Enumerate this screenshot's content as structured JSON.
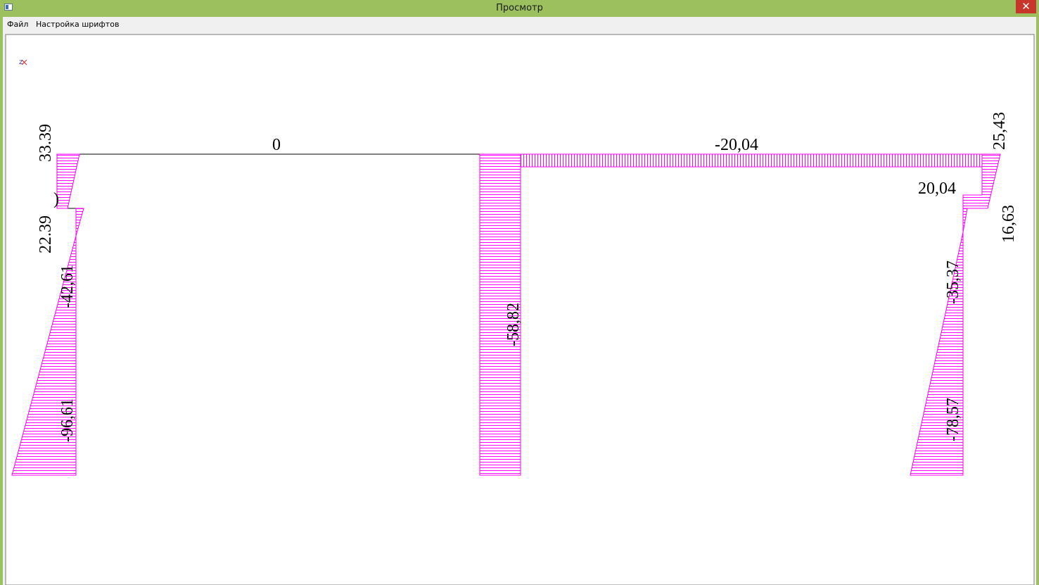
{
  "window": {
    "title": "Просмотр",
    "close_glyph": "✕"
  },
  "menu": {
    "file": "Файл",
    "font_settings": "Настройка шрифтов"
  },
  "diagram": {
    "hatch_color": "#ff00ff",
    "axis_icon": "axis-icon",
    "labels": {
      "top_left": "33.39",
      "left_lower": "22.39",
      "left_mid": "-42,61",
      "left_bottom": "-96,61",
      "span_left": "0",
      "column_center": "-58,82",
      "span_right": "-20,04",
      "right_top": "25,43",
      "right_mid": "20,04",
      "right_side": "16,63",
      "right_col_mid": "-35,37",
      "right_col_bottom": "-78,57",
      "left_partial": ")"
    }
  }
}
